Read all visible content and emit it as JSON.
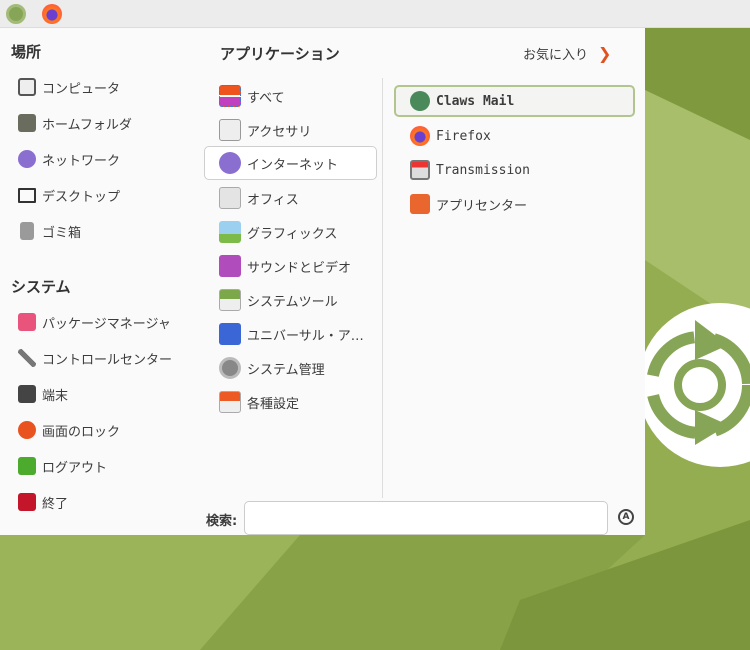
{
  "panel": {
    "items": [
      "ubuntu-mate-menu",
      "firefox"
    ]
  },
  "places": {
    "title": "場所",
    "items": [
      "コンピュータ",
      "ホームフォルダ",
      "ネットワーク",
      "デスクトップ",
      "ゴミ箱"
    ]
  },
  "system": {
    "title": "システム",
    "items": [
      "パッケージマネージャ",
      "コントロールセンター",
      "端末",
      "画面のロック",
      "ログアウト",
      "終了"
    ]
  },
  "applications": {
    "title": "アプリケーション",
    "categories": [
      "すべて",
      "アクセサリ",
      "インターネット",
      "オフィス",
      "グラフィックス",
      "サウンドとビデオ",
      "システムツール",
      "ユニバーサル・ア…",
      "システム管理",
      "各種設定"
    ],
    "selected": "インターネット"
  },
  "favorites": {
    "label": "お気に入り",
    "apps": [
      "Claws Mail",
      "Firefox",
      "Transmission",
      "アプリセンター"
    ]
  },
  "search": {
    "label": "検索:",
    "value": "",
    "placeholder": ""
  },
  "colors": {
    "accent": "#87a556",
    "desktop": "#8fa84a"
  }
}
